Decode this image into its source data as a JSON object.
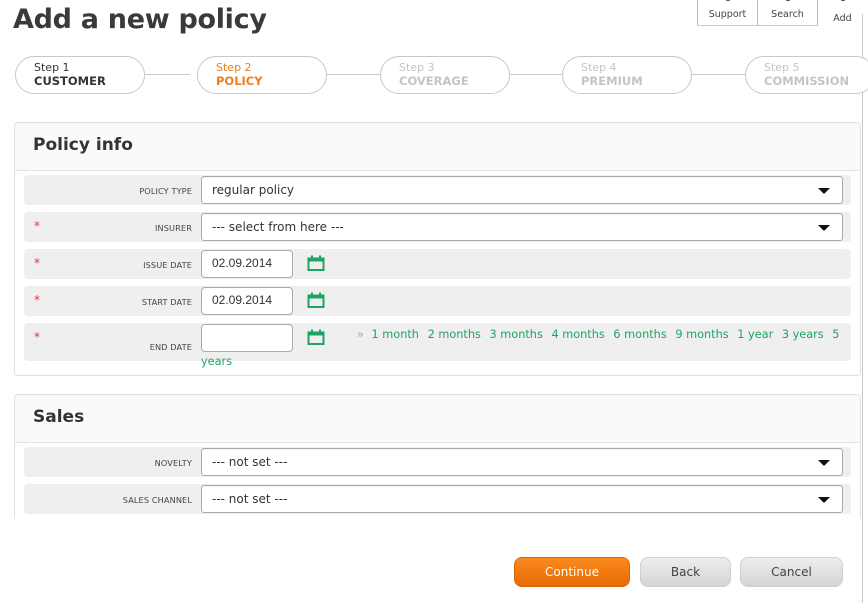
{
  "page": {
    "title": "Add a new policy"
  },
  "toolbar": {
    "items": [
      {
        "label": "Support",
        "icon": "support-icon"
      },
      {
        "label": "Search",
        "icon": "search-icon"
      },
      {
        "label": "Add",
        "icon": "add-icon"
      }
    ]
  },
  "wizard": {
    "steps": [
      {
        "number": "Step 1",
        "name": "CUSTOMER",
        "state": "done"
      },
      {
        "number": "Step 2",
        "name": "POLICY",
        "state": "active"
      },
      {
        "number": "Step 3",
        "name": "COVERAGE",
        "state": "future"
      },
      {
        "number": "Step 4",
        "name": "PREMIUM",
        "state": "future"
      },
      {
        "number": "Step 5",
        "name": "COMMISSION",
        "state": "future"
      }
    ],
    "colors": {
      "active": "#f07d1a",
      "done": "#333333",
      "future": "#c4c4c4"
    }
  },
  "policy_info": {
    "title": "Policy info",
    "required_marker": "*",
    "fields": {
      "policy_type": {
        "label": "POLICY TYPE",
        "value": "regular policy",
        "required": false
      },
      "insurer": {
        "label": "INSURER",
        "value": "--- select from here ---",
        "required": true
      },
      "issue_date": {
        "label": "ISSUE DATE",
        "value": "02.09.2014",
        "required": true
      },
      "start_date": {
        "label": "START DATE",
        "value": "02.09.2014",
        "required": true
      },
      "end_date": {
        "label": "END DATE",
        "value": "",
        "required": true
      }
    },
    "quick_durations": {
      "prefix": "»",
      "options": [
        "1 month",
        "2 months",
        "3 months",
        "4 months",
        "6 months",
        "9 months",
        "1 year",
        "3 years"
      ],
      "last_option_part1": "5",
      "last_option_part2": "years"
    }
  },
  "sales": {
    "title": "Sales",
    "fields": {
      "novelty": {
        "label": "NOVELTY",
        "value": "--- not set ---"
      },
      "sales_channel": {
        "label": "SALES CHANNEL",
        "value": "--- not set ---"
      }
    }
  },
  "actions": {
    "continue": "Continue",
    "back": "Back",
    "cancel": "Cancel"
  },
  "colors": {
    "accent_orange": "#f07d1a",
    "link_green": "#1fa463",
    "required_red": "#e23a3a"
  }
}
